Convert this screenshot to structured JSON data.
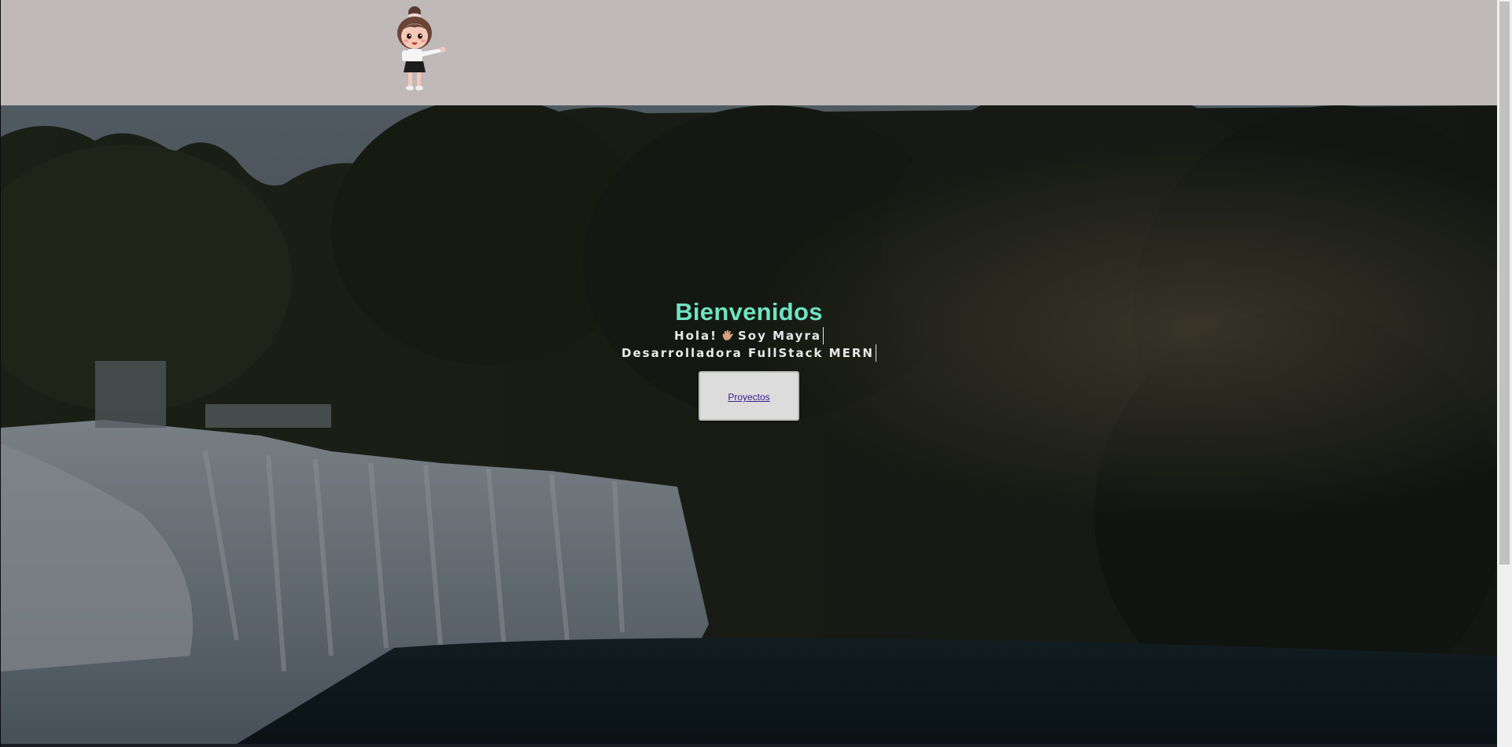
{
  "header": {
    "avatar_icon": "cartoon-girl-avatar-icon",
    "background": "#bfb9ba"
  },
  "hero": {
    "background_image": "waterfall-jungle-image",
    "title": "Bienvenidos",
    "greeting_prefix": "Hola!",
    "greeting_icon": "waving-hand-icon",
    "greeting_suffix": "Soy Mayra",
    "role": "Desarrolladora FullStack MERN",
    "button_label": "Proyectos",
    "title_color": "#6fe3c2"
  }
}
